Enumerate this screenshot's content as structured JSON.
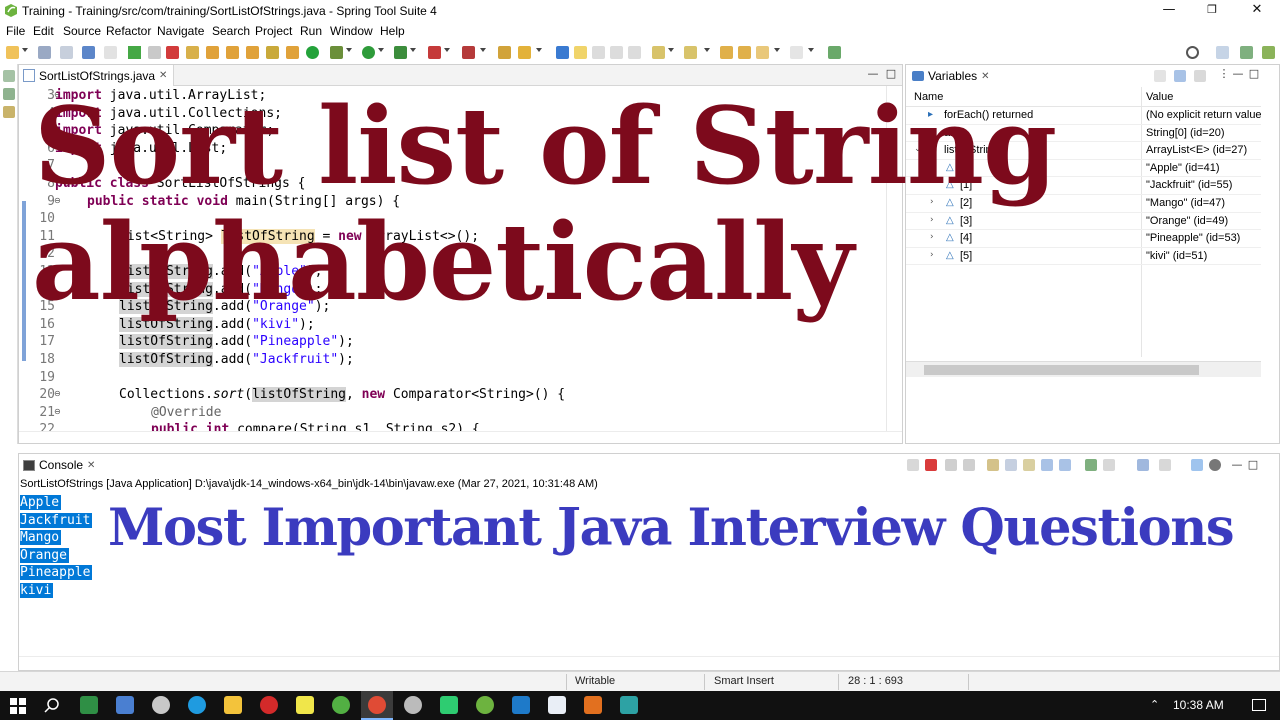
{
  "window": {
    "title": "Training - Training/src/com/training/SortListOfStrings.java - Spring Tool Suite 4",
    "controls": [
      "—",
      "❐",
      "✕"
    ]
  },
  "menu": [
    "File",
    "Edit",
    "Source",
    "Refactor",
    "Navigate",
    "Search",
    "Project",
    "Run",
    "Window",
    "Help"
  ],
  "editor": {
    "tab_label": "SortListOfStrings.java",
    "lines": [
      {
        "no": "3",
        "fold": "⊖"
      },
      {
        "no": "4",
        "fold": ""
      },
      {
        "no": "5",
        "fold": ""
      },
      {
        "no": "6",
        "fold": ""
      },
      {
        "no": "7",
        "fold": ""
      },
      {
        "no": "8",
        "fold": ""
      },
      {
        "no": "9",
        "fold": "⊖"
      },
      {
        "no": "10",
        "fold": ""
      },
      {
        "no": "11",
        "fold": ""
      },
      {
        "no": "12",
        "fold": ""
      },
      {
        "no": "13",
        "fold": ""
      },
      {
        "no": "14",
        "fold": ""
      },
      {
        "no": "15",
        "fold": ""
      },
      {
        "no": "16",
        "fold": ""
      },
      {
        "no": "17",
        "fold": ""
      },
      {
        "no": "18",
        "fold": ""
      },
      {
        "no": "19",
        "fold": ""
      },
      {
        "no": "20",
        "fold": "⊖"
      },
      {
        "no": "21",
        "fold": "⊖"
      },
      {
        "no": "22",
        "fold": ""
      }
    ],
    "code": {
      "l3": {
        "kw": "import",
        "rest": " java.util.ArrayList;"
      },
      "l4": {
        "kw": "import",
        "rest": " java.util.Collections;"
      },
      "l5": {
        "kw": "import",
        "rest": " java.util.Comparator;"
      },
      "l6": {
        "kw": "import",
        "rest": " java.util.List;"
      },
      "l8": {
        "kw1": "public",
        "kw2": " class",
        "rest": " SortListOfStrings {"
      },
      "l9": {
        "kw1": "public",
        "kw2": " static",
        "kw3": " void",
        "rest": " main(String[] args) {"
      },
      "l11": {
        "pre": "List<String> ",
        "var": "listOfString",
        "mid": " = ",
        "kw": "new",
        "rest": " ArrayList<>();"
      },
      "l13": {
        "var": "listOfString",
        "mid": ".add(",
        "str": "\"Apple\"",
        "rest": ");"
      },
      "l14": {
        "var": "listOfString",
        "mid": ".add(",
        "str": "\"Mango\"",
        "rest": ");"
      },
      "l15": {
        "var": "listOfString",
        "mid": ".add(",
        "str": "\"Orange\"",
        "rest": ");"
      },
      "l16": {
        "var": "listOfString",
        "mid": ".add(",
        "str": "\"kivi\"",
        "rest": ");"
      },
      "l17": {
        "var": "listOfString",
        "mid": ".add(",
        "str": "\"Pineapple\"",
        "rest": ");"
      },
      "l18": {
        "var": "listOfString",
        "mid": ".add(",
        "str": "\"Jackfruit\"",
        "rest": ");"
      },
      "l20": {
        "pre": "Collections.",
        "method": "sort",
        "paren": "(",
        "var": "listOfString",
        "mid": ", ",
        "kw": "new",
        "rest": " Comparator<String>() {"
      },
      "l21": {
        "ann": "@Override"
      },
      "l22": {
        "kw1": "public",
        "kw2": " int",
        "rest": " compare(String s1, String s2) {"
      }
    }
  },
  "variables": {
    "tab_label": "Variables",
    "col_name": "Name",
    "col_value": "Value",
    "rows": [
      {
        "name": "forEach() returned",
        "value": "(No explicit return value"
      },
      {
        "name": "args",
        "value": "String[0]  (id=20)"
      },
      {
        "name": "listOfString",
        "value": "ArrayList<E>  (id=27)"
      },
      {
        "name": "[0]",
        "value": "\"Apple\" (id=41)"
      },
      {
        "name": "[1]",
        "value": "\"Jackfruit\" (id=55)"
      },
      {
        "name": "[2]",
        "value": "\"Mango\" (id=47)"
      },
      {
        "name": "[3]",
        "value": "\"Orange\" (id=49)"
      },
      {
        "name": "[4]",
        "value": "\"Pineapple\" (id=53)"
      },
      {
        "name": "[5]",
        "value": "\"kivi\" (id=51)"
      }
    ]
  },
  "console": {
    "tab_label": "Console",
    "launch": "SortListOfStrings [Java Application] D:\\java\\jdk-14_windows-x64_bin\\jdk-14\\bin\\javaw.exe  (Mar 27, 2021, 10:31:48 AM)",
    "output": [
      "Apple",
      "Jackfruit",
      "Mango",
      "Orange",
      "Pineapple",
      "kivi"
    ]
  },
  "status": {
    "writable": "Writable",
    "insert_mode": "Smart Insert",
    "position": "28 : 1 : 693"
  },
  "taskbar": {
    "clock": "10:38 AM"
  },
  "overlay": {
    "title_line1": "Sort list of String",
    "title_line2": "alphabetically",
    "subtitle": "Most Important Java Interview Questions"
  },
  "colors": {
    "overlay_title": "#7d0a1c",
    "overlay_subtitle": "#3b3bbf",
    "console_selection": "#0078d7",
    "keyword": "#7f0055",
    "string": "#2a00ff"
  }
}
